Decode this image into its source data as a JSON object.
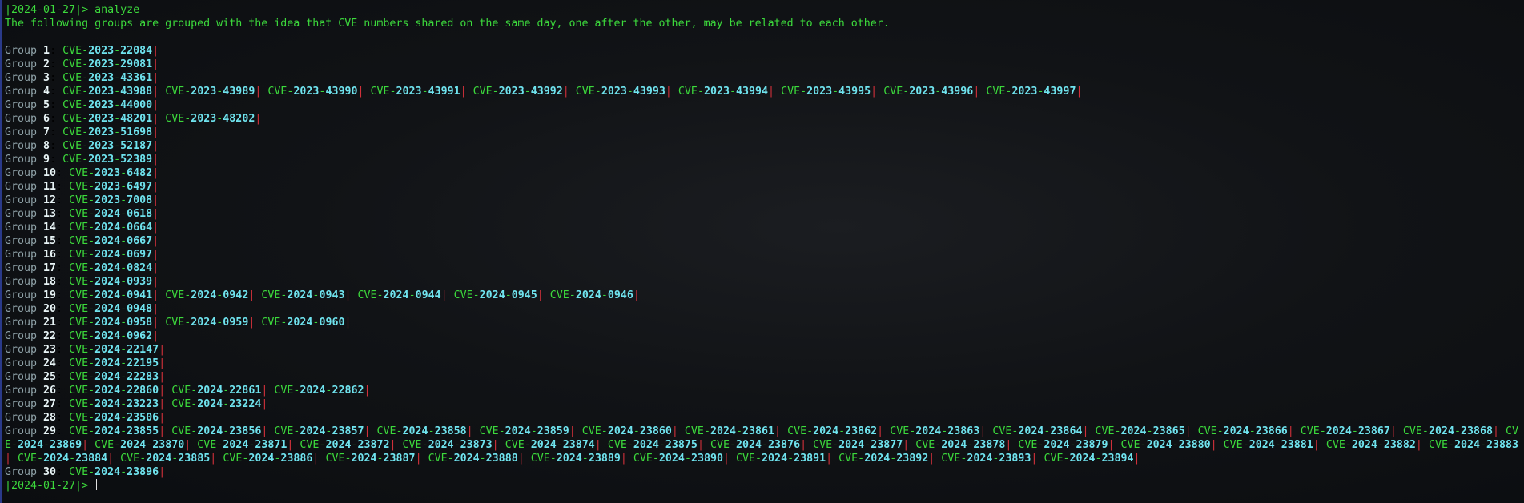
{
  "terminal": {
    "prompt": "|2024-01-27|>",
    "command": "analyze",
    "description": "The following groups are grouped with the idea that CVE numbers shared on the same day, one after the other, may be related to each other.",
    "group_label": "Group",
    "separator": "|",
    "groups": [
      {
        "n": "1",
        "cves": [
          "CVE-2023-22084"
        ]
      },
      {
        "n": "2",
        "cves": [
          "CVE-2023-29081"
        ]
      },
      {
        "n": "3",
        "cves": [
          "CVE-2023-43361"
        ]
      },
      {
        "n": "4",
        "cves": [
          "CVE-2023-43988",
          "CVE-2023-43989",
          "CVE-2023-43990",
          "CVE-2023-43991",
          "CVE-2023-43992",
          "CVE-2023-43993",
          "CVE-2023-43994",
          "CVE-2023-43995",
          "CVE-2023-43996",
          "CVE-2023-43997"
        ]
      },
      {
        "n": "5",
        "cves": [
          "CVE-2023-44000"
        ]
      },
      {
        "n": "6",
        "cves": [
          "CVE-2023-48201",
          "CVE-2023-48202"
        ]
      },
      {
        "n": "7",
        "cves": [
          "CVE-2023-51698"
        ]
      },
      {
        "n": "8",
        "cves": [
          "CVE-2023-52187"
        ]
      },
      {
        "n": "9",
        "cves": [
          "CVE-2023-52389"
        ]
      },
      {
        "n": "10",
        "cves": [
          "CVE-2023-6482"
        ]
      },
      {
        "n": "11",
        "cves": [
          "CVE-2023-6497"
        ]
      },
      {
        "n": "12",
        "cves": [
          "CVE-2023-7008"
        ]
      },
      {
        "n": "13",
        "cves": [
          "CVE-2024-0618"
        ]
      },
      {
        "n": "14",
        "cves": [
          "CVE-2024-0664"
        ]
      },
      {
        "n": "15",
        "cves": [
          "CVE-2024-0667"
        ]
      },
      {
        "n": "16",
        "cves": [
          "CVE-2024-0697"
        ]
      },
      {
        "n": "17",
        "cves": [
          "CVE-2024-0824"
        ]
      },
      {
        "n": "18",
        "cves": [
          "CVE-2024-0939"
        ]
      },
      {
        "n": "19",
        "cves": [
          "CVE-2024-0941",
          "CVE-2024-0942",
          "CVE-2024-0943",
          "CVE-2024-0944",
          "CVE-2024-0945",
          "CVE-2024-0946"
        ]
      },
      {
        "n": "20",
        "cves": [
          "CVE-2024-0948"
        ]
      },
      {
        "n": "21",
        "cves": [
          "CVE-2024-0958",
          "CVE-2024-0959",
          "CVE-2024-0960"
        ]
      },
      {
        "n": "22",
        "cves": [
          "CVE-2024-0962"
        ]
      },
      {
        "n": "23",
        "cves": [
          "CVE-2024-22147"
        ]
      },
      {
        "n": "24",
        "cves": [
          "CVE-2024-22195"
        ]
      },
      {
        "n": "25",
        "cves": [
          "CVE-2024-22283"
        ]
      },
      {
        "n": "26",
        "cves": [
          "CVE-2024-22860",
          "CVE-2024-22861",
          "CVE-2024-22862"
        ]
      },
      {
        "n": "27",
        "cves": [
          "CVE-2024-23223",
          "CVE-2024-23224"
        ]
      },
      {
        "n": "28",
        "cves": [
          "CVE-2024-23506"
        ]
      },
      {
        "n": "29",
        "cves": [
          "CVE-2024-23855",
          "CVE-2024-23856",
          "CVE-2024-23857",
          "CVE-2024-23858",
          "CVE-2024-23859",
          "CVE-2024-23860",
          "CVE-2024-23861",
          "CVE-2024-23862",
          "CVE-2024-23863",
          "CVE-2024-23864",
          "CVE-2024-23865",
          "CVE-2024-23866",
          "CVE-2024-23867",
          "CVE-2024-23868",
          "CVE-2024-23869",
          "CVE-2024-23870",
          "CVE-2024-23871",
          "CVE-2024-23872",
          "CVE-2024-23873",
          "CVE-2024-23874",
          "CVE-2024-23875",
          "CVE-2024-23876",
          "CVE-2024-23877",
          "CVE-2024-23878",
          "CVE-2024-23879",
          "CVE-2024-23880",
          "CVE-2024-23881",
          "CVE-2024-23882",
          "CVE-2024-23883",
          "CVE-2024-23884",
          "CVE-2024-23885",
          "CVE-2024-23886",
          "CVE-2024-23887",
          "CVE-2024-23888",
          "CVE-2024-23889",
          "CVE-2024-23890",
          "CVE-2024-23891",
          "CVE-2024-23892",
          "CVE-2024-23893",
          "CVE-2024-23894"
        ]
      },
      {
        "n": "30",
        "cves": [
          "CVE-2024-23896"
        ]
      }
    ]
  },
  "colors": {
    "prompt": "#3cd93c",
    "cve_id": "#6fe3ee",
    "separator": "#d0303a",
    "group_label": "#8fa2a8"
  }
}
